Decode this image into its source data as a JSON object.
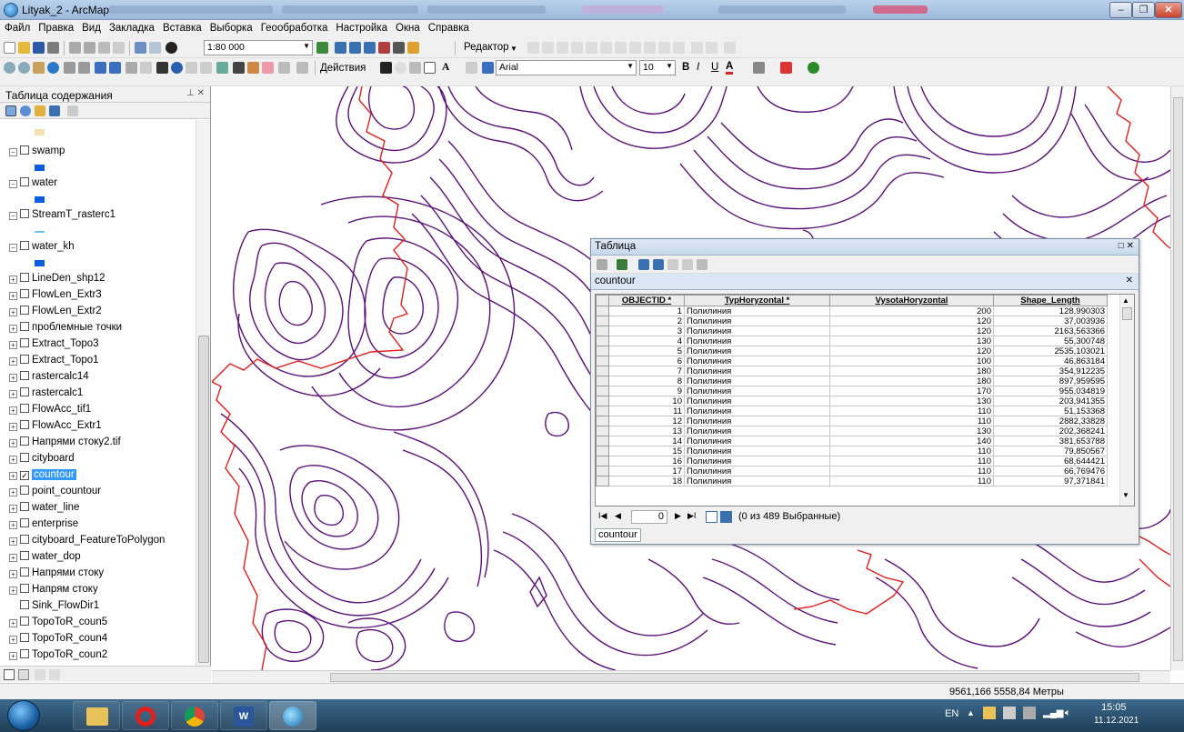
{
  "window": {
    "title": "Lityak_2 - ArcMap"
  },
  "menu": [
    "Файл",
    "Правка",
    "Вид",
    "Закладка",
    "Вставка",
    "Выборка",
    "Геообработка",
    "Настройка",
    "Окна",
    "Справка"
  ],
  "toolbar1": {
    "scale": "1:80 000",
    "editor": "Редактор"
  },
  "toolbar2": {
    "actions": "Действия",
    "font": "Arial",
    "font_size": "10",
    "bold": "B",
    "italic": "I",
    "underline": "U"
  },
  "toc": {
    "title": "Таблица содержания",
    "layers": [
      {
        "name": "swamp",
        "exp": "⊟",
        "checked": false
      },
      {
        "name": "water",
        "exp": "⊟",
        "checked": false
      },
      {
        "name": "StreamT_rasterc1",
        "exp": "⊟",
        "checked": false
      },
      {
        "name": "water_kh",
        "exp": "⊟",
        "checked": false
      },
      {
        "name": "LineDen_shp12",
        "exp": "⊞",
        "checked": false
      },
      {
        "name": "FlowLen_Extr3",
        "exp": "⊞",
        "checked": false
      },
      {
        "name": "FlowLen_Extr2",
        "exp": "⊞",
        "checked": false
      },
      {
        "name": "проблемные точки",
        "exp": "⊞",
        "checked": false
      },
      {
        "name": "Extract_Topo3",
        "exp": "⊞",
        "checked": false
      },
      {
        "name": "Extract_Topo1",
        "exp": "⊞",
        "checked": false
      },
      {
        "name": "rastercalc14",
        "exp": "⊞",
        "checked": false
      },
      {
        "name": "rastercalc1",
        "exp": "⊞",
        "checked": false
      },
      {
        "name": "FlowAcc_tif1",
        "exp": "⊞",
        "checked": false
      },
      {
        "name": "FlowAcc_Extr1",
        "exp": "⊞",
        "checked": false
      },
      {
        "name": "Напрями стоку2.tif",
        "exp": "⊞",
        "checked": false
      },
      {
        "name": "cityboard",
        "exp": "⊞",
        "checked": false
      },
      {
        "name": "countour",
        "exp": "⊞",
        "checked": true,
        "selected": true
      },
      {
        "name": "point_countour",
        "exp": "⊞",
        "checked": false
      },
      {
        "name": "water_line",
        "exp": "⊞",
        "checked": false
      },
      {
        "name": "enterprise",
        "exp": "⊞",
        "checked": false
      },
      {
        "name": "cityboard_FeatureToPolygon",
        "exp": "⊞",
        "checked": false
      },
      {
        "name": "water_dop",
        "exp": "⊞",
        "checked": false
      },
      {
        "name": "Напрями стоку",
        "exp": "⊞",
        "checked": false
      },
      {
        "name": "Напрям стоку",
        "exp": "⊞",
        "checked": false
      },
      {
        "name": "Sink_FlowDir1",
        "exp": "",
        "checked": false
      },
      {
        "name": "TopoToR_coun5",
        "exp": "⊞",
        "checked": false
      },
      {
        "name": "TopoToR_coun4",
        "exp": "⊞",
        "checked": false
      },
      {
        "name": "TopoToR_coun2",
        "exp": "⊞",
        "checked": false
      }
    ]
  },
  "table_window": {
    "title": "Таблица",
    "tab": "countour",
    "columns": [
      "OBJECTID *",
      "TypHoryzontal *",
      "VysotaHoryzontal",
      "Shape_Length"
    ],
    "rows": [
      [
        "1",
        "Полилиния",
        "200",
        "128,990303"
      ],
      [
        "2",
        "Полилиния",
        "120",
        "37,003936"
      ],
      [
        "3",
        "Полилиния",
        "120",
        "2163,563366"
      ],
      [
        "4",
        "Полилиния",
        "130",
        "55,300748"
      ],
      [
        "5",
        "Полилиния",
        "120",
        "2535,103021"
      ],
      [
        "6",
        "Полилиния",
        "100",
        "46,863184"
      ],
      [
        "7",
        "Полилиния",
        "180",
        "354,912235"
      ],
      [
        "8",
        "Полилиния",
        "180",
        "897,959595"
      ],
      [
        "9",
        "Полилиния",
        "170",
        "955,034819"
      ],
      [
        "10",
        "Полилиния",
        "130",
        "203,941355"
      ],
      [
        "11",
        "Полилиния",
        "110",
        "51,153368"
      ],
      [
        "12",
        "Полилиния",
        "110",
        "2882,33828"
      ],
      [
        "13",
        "Полилиния",
        "130",
        "202,368241"
      ],
      [
        "14",
        "Полилиния",
        "140",
        "381,653788"
      ],
      [
        "15",
        "Полилиния",
        "110",
        "79,850567"
      ],
      [
        "16",
        "Полилиния",
        "110",
        "68,644421"
      ],
      [
        "17",
        "Полилиния",
        "110",
        "66,769476"
      ],
      [
        "18",
        "Полилиния",
        "110",
        "97,371841"
      ]
    ],
    "current_record": "0",
    "selection_status": "(0 из 489 Выбранные)",
    "bottom_tab": "countour"
  },
  "status": {
    "coords": "9561,166  5558,84 Метры"
  },
  "taskbar": {
    "lang": "EN",
    "time": "15:05",
    "date": "11.12.2021"
  },
  "colors": {
    "contour": "#5a0f7a",
    "boundary": "#e0201c",
    "selection": "#3399ff"
  }
}
